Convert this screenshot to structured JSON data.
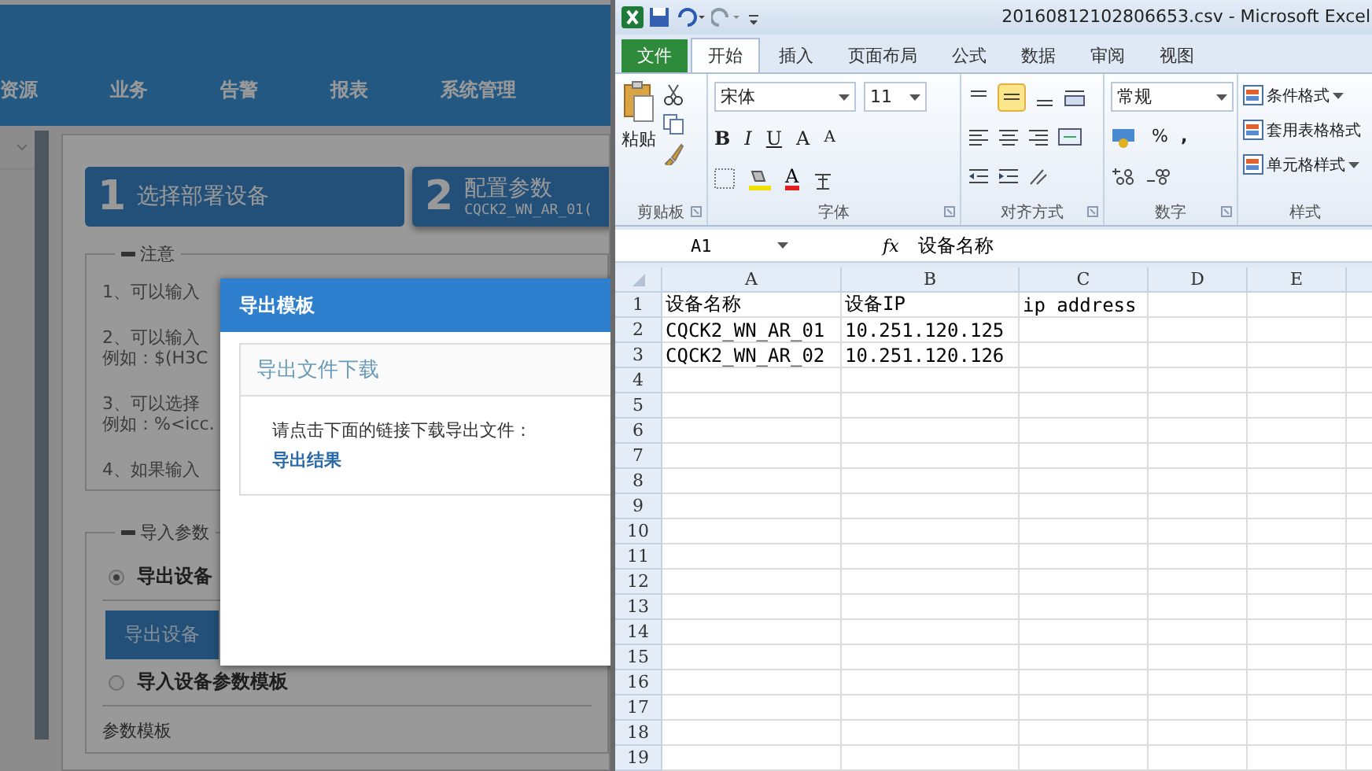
{
  "app": {
    "nav": [
      "资源",
      "业务",
      "告警",
      "报表",
      "系统管理"
    ],
    "steps": [
      {
        "number": "1",
        "title": "选择部署设备"
      },
      {
        "number": "2",
        "title": "配置参数",
        "subtitle": "CQCK2_WN_AR_01("
      }
    ],
    "notes": {
      "legend": "注意",
      "items": [
        {
          "lines": [
            "1、可以输入"
          ]
        },
        {
          "lines": [
            "2、可以输入",
            "例如：$(H3C"
          ]
        },
        {
          "lines": [
            "3、可以选择",
            "例如：%<icc."
          ]
        },
        {
          "lines": [
            "4、如果输入"
          ]
        }
      ]
    },
    "import": {
      "legend": "导入参数",
      "options": [
        {
          "label": "导出设备",
          "selected": true
        },
        {
          "label": "导入设备参数模板",
          "selected": false
        }
      ],
      "button": "导出设备",
      "template_label": "参数模板"
    },
    "dialog": {
      "title": "导出模板",
      "panel_title": "导出文件下载",
      "message": "请点击下面的链接下载导出文件：",
      "link": "导出结果"
    }
  },
  "excel": {
    "title": "20160812102806653.csv - Microsoft Excel",
    "tabs": [
      {
        "label": "文件",
        "kind": "file",
        "selected": false
      },
      {
        "label": "开始",
        "kind": "tab",
        "selected": true
      },
      {
        "label": "插入",
        "kind": "tab",
        "selected": false
      },
      {
        "label": "页面布局",
        "kind": "tab",
        "selected": false
      },
      {
        "label": "公式",
        "kind": "tab",
        "selected": false
      },
      {
        "label": "数据",
        "kind": "tab",
        "selected": false
      },
      {
        "label": "审阅",
        "kind": "tab",
        "selected": false
      },
      {
        "label": "视图",
        "kind": "tab",
        "selected": false
      }
    ],
    "ribbon": {
      "paste": "粘贴",
      "font_name": "宋体",
      "font_size": "11",
      "format_buttons": [
        "B",
        "I",
        "U",
        "A",
        "A"
      ],
      "font_color": "A",
      "number_format": "常规",
      "percent": "%",
      "comma": ",",
      "styles": [
        {
          "label": "条件格式",
          "dropdown": true
        },
        {
          "label": "套用表格格式",
          "dropdown": false
        },
        {
          "label": "单元格样式",
          "dropdown": true
        }
      ],
      "groups": [
        "剪贴板",
        "字体",
        "对齐方式",
        "数字",
        "样式"
      ]
    },
    "name_box": "A1",
    "fx": "fx",
    "formula": "设备名称",
    "columns": [
      "A",
      "B",
      "C",
      "D",
      "E"
    ],
    "rows": [
      {
        "number": "1",
        "cells": [
          "设备名称",
          "设备IP",
          "ip address"
        ]
      },
      {
        "number": "2",
        "cells": [
          "CQCK2_WN_AR_01",
          "10.251.120.125"
        ]
      },
      {
        "number": "3",
        "cells": [
          "CQCK2_WN_AR_02",
          "10.251.120.126"
        ]
      },
      {
        "number": "4"
      },
      {
        "number": "5"
      },
      {
        "number": "6"
      },
      {
        "number": "7"
      },
      {
        "number": "8"
      },
      {
        "number": "9"
      },
      {
        "number": "10"
      },
      {
        "number": "11"
      },
      {
        "number": "12"
      },
      {
        "number": "13"
      },
      {
        "number": "14"
      },
      {
        "number": "15"
      },
      {
        "number": "16"
      },
      {
        "number": "17"
      },
      {
        "number": "18"
      },
      {
        "number": "19"
      }
    ]
  }
}
